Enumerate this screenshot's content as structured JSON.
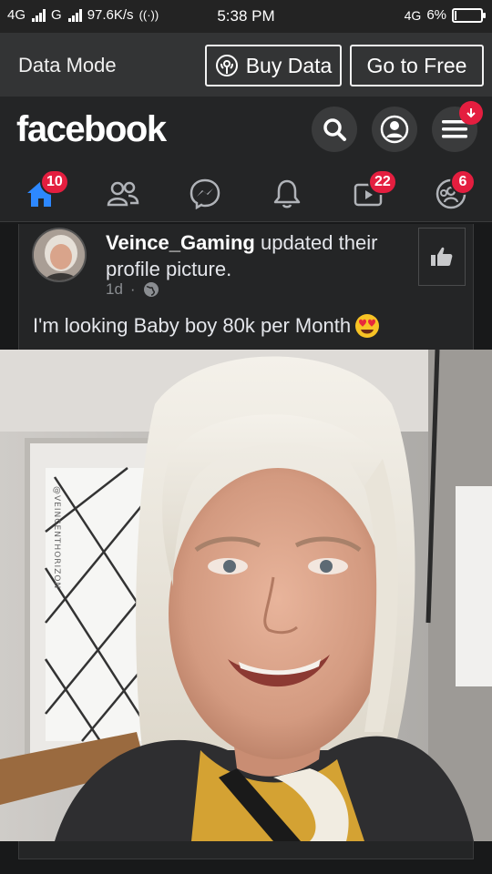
{
  "status_bar": {
    "network1": "4G",
    "network2": "G",
    "speed": "97.6K/s",
    "time": "5:38 PM",
    "network3": "4G",
    "battery": "6%",
    "battery_level": 0.06
  },
  "data_bar": {
    "label": "Data Mode",
    "buy_label": "Buy Data",
    "free_label": "Go to Free"
  },
  "header": {
    "logo": "facebook"
  },
  "tabs": [
    {
      "name": "home",
      "badge": "10",
      "active": true
    },
    {
      "name": "friends",
      "badge": ""
    },
    {
      "name": "messenger",
      "badge": ""
    },
    {
      "name": "notifications",
      "badge": ""
    },
    {
      "name": "watch",
      "badge": "22"
    },
    {
      "name": "groups",
      "badge": "6"
    }
  ],
  "post": {
    "author": "Veince_Gaming",
    "action": " updated their profile picture.",
    "time": "1d",
    "separator": "·",
    "text": "I'm looking Baby boy 80k per Month",
    "emoji": "😍",
    "watermark": "@VEINCENTHORIZON"
  },
  "colors": {
    "accent": "#2d88ff",
    "badge": "#e41e3f",
    "background": "#18191a",
    "surface": "#242526"
  }
}
